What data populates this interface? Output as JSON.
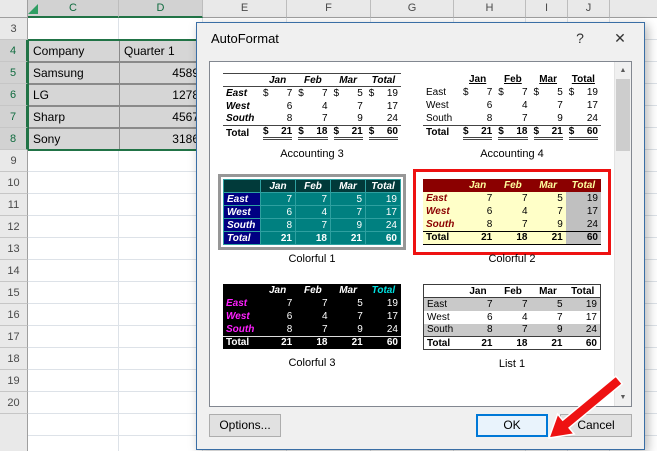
{
  "spreadsheet": {
    "column_headers": [
      "C",
      "D",
      "E",
      "F",
      "G",
      "H",
      "I",
      "J"
    ],
    "row_numbers": [
      "3",
      "4",
      "5",
      "6",
      "7",
      "8",
      "9",
      "10",
      "11",
      "12",
      "13",
      "14",
      "15",
      "16",
      "17",
      "18",
      "19",
      "20"
    ],
    "selected_range_rows": [
      "4",
      "5",
      "6",
      "7",
      "8"
    ],
    "table": {
      "headers": [
        "Company",
        "Quarter 1"
      ],
      "rows": [
        [
          "Samsung",
          "4589"
        ],
        [
          "LG",
          "1278"
        ],
        [
          "Sharp",
          "4567"
        ],
        [
          "Sony",
          "3186"
        ]
      ]
    }
  },
  "dialog": {
    "title": "AutoFormat",
    "footer": {
      "options_label": "Options...",
      "ok_label": "OK",
      "cancel_label": "Cancel"
    },
    "gallery": {
      "columns": [
        "Jan",
        "Feb",
        "Mar",
        "Total"
      ],
      "previews": [
        {
          "label": "Accounting 3",
          "style": "accounting3",
          "selected": false,
          "annotated": false,
          "rows": [
            {
              "label": "East",
              "values": [
                "7",
                "7",
                "5",
                "19"
              ],
              "dollar": true,
              "total": false
            },
            {
              "label": "West",
              "values": [
                "6",
                "4",
                "7",
                "17"
              ],
              "dollar": false,
              "total": false
            },
            {
              "label": "South",
              "values": [
                "8",
                "7",
                "9",
                "24"
              ],
              "dollar": false,
              "total": false
            },
            {
              "label": "Total",
              "values": [
                "21",
                "18",
                "21",
                "60"
              ],
              "dollar": true,
              "total": true
            }
          ]
        },
        {
          "label": "Accounting 4",
          "style": "accounting4",
          "selected": false,
          "annotated": false,
          "rows": [
            {
              "label": "East",
              "values": [
                "7",
                "7",
                "5",
                "19"
              ],
              "dollar": true,
              "total": false
            },
            {
              "label": "West",
              "values": [
                "6",
                "4",
                "7",
                "17"
              ],
              "dollar": false,
              "total": false
            },
            {
              "label": "South",
              "values": [
                "8",
                "7",
                "9",
                "24"
              ],
              "dollar": false,
              "total": false
            },
            {
              "label": "Total",
              "values": [
                "21",
                "18",
                "21",
                "60"
              ],
              "dollar": true,
              "total": true
            }
          ]
        },
        {
          "label": "Colorful 1",
          "style": "colorful1",
          "selected": true,
          "annotated": false,
          "rows": [
            {
              "label": "East",
              "values": [
                "7",
                "7",
                "5",
                "19"
              ],
              "dollar": false,
              "total": false
            },
            {
              "label": "West",
              "values": [
                "6",
                "4",
                "7",
                "17"
              ],
              "dollar": false,
              "total": false
            },
            {
              "label": "South",
              "values": [
                "8",
                "7",
                "9",
                "24"
              ],
              "dollar": false,
              "total": false
            },
            {
              "label": "Total",
              "values": [
                "21",
                "18",
                "21",
                "60"
              ],
              "dollar": false,
              "total": true
            }
          ]
        },
        {
          "label": "Colorful 2",
          "style": "colorful2",
          "selected": false,
          "annotated": true,
          "rows": [
            {
              "label": "East",
              "values": [
                "7",
                "7",
                "5",
                "19"
              ],
              "dollar": false,
              "total": false
            },
            {
              "label": "West",
              "values": [
                "6",
                "4",
                "7",
                "17"
              ],
              "dollar": false,
              "total": false
            },
            {
              "label": "South",
              "values": [
                "8",
                "7",
                "9",
                "24"
              ],
              "dollar": false,
              "total": false
            },
            {
              "label": "Total",
              "values": [
                "21",
                "18",
                "21",
                "60"
              ],
              "dollar": false,
              "total": true
            }
          ]
        },
        {
          "label": "Colorful 3",
          "style": "colorful3",
          "selected": false,
          "annotated": false,
          "rows": [
            {
              "label": "East",
              "values": [
                "7",
                "7",
                "5",
                "19"
              ],
              "dollar": false,
              "total": false
            },
            {
              "label": "West",
              "values": [
                "6",
                "4",
                "7",
                "17"
              ],
              "dollar": false,
              "total": false
            },
            {
              "label": "South",
              "values": [
                "8",
                "7",
                "9",
                "24"
              ],
              "dollar": false,
              "total": false
            },
            {
              "label": "Total",
              "values": [
                "21",
                "18",
                "21",
                "60"
              ],
              "dollar": false,
              "total": true
            }
          ]
        },
        {
          "label": "List 1",
          "style": "list1",
          "selected": false,
          "annotated": false,
          "rows": [
            {
              "label": "East",
              "values": [
                "7",
                "7",
                "5",
                "19"
              ],
              "dollar": false,
              "total": false
            },
            {
              "label": "West",
              "values": [
                "6",
                "4",
                "7",
                "17"
              ],
              "dollar": false,
              "total": false
            },
            {
              "label": "South",
              "values": [
                "8",
                "7",
                "9",
                "24"
              ],
              "dollar": false,
              "total": false
            },
            {
              "label": "Total",
              "values": [
                "21",
                "18",
                "21",
                "60"
              ],
              "dollar": false,
              "total": true
            }
          ]
        }
      ]
    }
  },
  "icons": {
    "help": "?",
    "close": "✕",
    "scroll_up": "▲",
    "scroll_down": "▼"
  },
  "colors": {
    "annotation": "#ee1111",
    "selection_green": "#217346",
    "focus_blue": "#0078d7"
  }
}
